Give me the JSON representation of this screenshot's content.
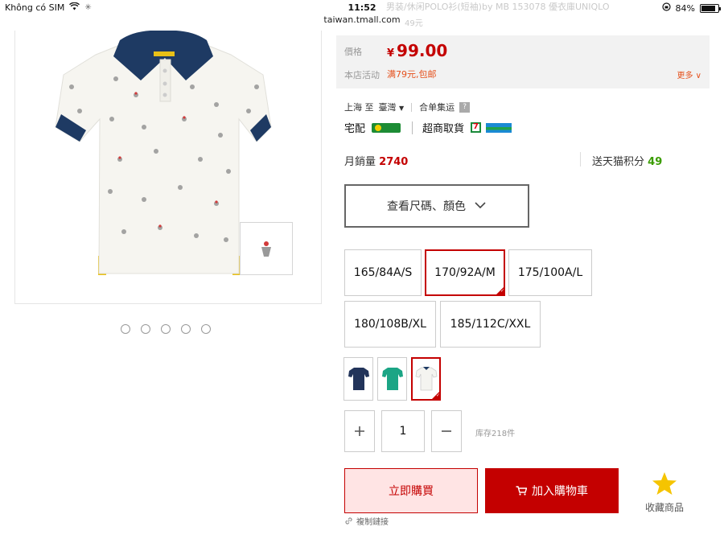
{
  "status_bar": {
    "carrier": "Không có SIM",
    "time": "11:52",
    "battery": "84%",
    "battery_level": 0.84
  },
  "browser": {
    "url": "taiwan.tmall.com"
  },
  "header_ghost": {
    "title": "男装/休闲POLO衫(短袖)by MB 153078 優衣庫UNIQLO",
    "price": "49元"
  },
  "gallery": {
    "dots": [
      1,
      2,
      3,
      4,
      5
    ],
    "colors": {
      "shirt": "#f6f5f0",
      "collar": "#1e3a63",
      "accent": "#e8c017"
    }
  },
  "price": {
    "label": "價格",
    "currency": "¥",
    "value": "99.00",
    "promo_label": "本店活动",
    "promo_text": "满79元,包邮",
    "more": "更多"
  },
  "shipping": {
    "from": "上海 至",
    "to": "臺灣",
    "combine": "合单集运",
    "home_delivery": "宅配",
    "store_pickup": "超商取貨"
  },
  "sales": {
    "monthly_label": "月銷量",
    "monthly_value": "2740",
    "points_label": "送天猫积分",
    "points_value": "49"
  },
  "options_toggle": {
    "label": "查看尺碼、顏色"
  },
  "sizes": [
    {
      "label": "165/84A/S",
      "selected": false
    },
    {
      "label": "170/92A/M",
      "selected": true
    },
    {
      "label": "175/100A/L",
      "selected": false
    },
    {
      "label": "180/108B/XL",
      "selected": false
    },
    {
      "label": "185/112C/XXL",
      "selected": false
    }
  ],
  "swatches": [
    {
      "color": "#22345a",
      "selected": false
    },
    {
      "color": "#1ba585",
      "selected": false
    },
    {
      "color": "#f4f4f0",
      "selected": true
    }
  ],
  "quantity": {
    "value": "1",
    "stock": "库存218件"
  },
  "actions": {
    "buy_now": "立即購買",
    "add_to_cart": "加入購物車",
    "favorite": "收藏商品",
    "copy_link": "複制鏈接"
  },
  "colors": {
    "brand_red": "#c40000",
    "promo_orange": "#e5511d",
    "points_green": "#3a9c00"
  }
}
